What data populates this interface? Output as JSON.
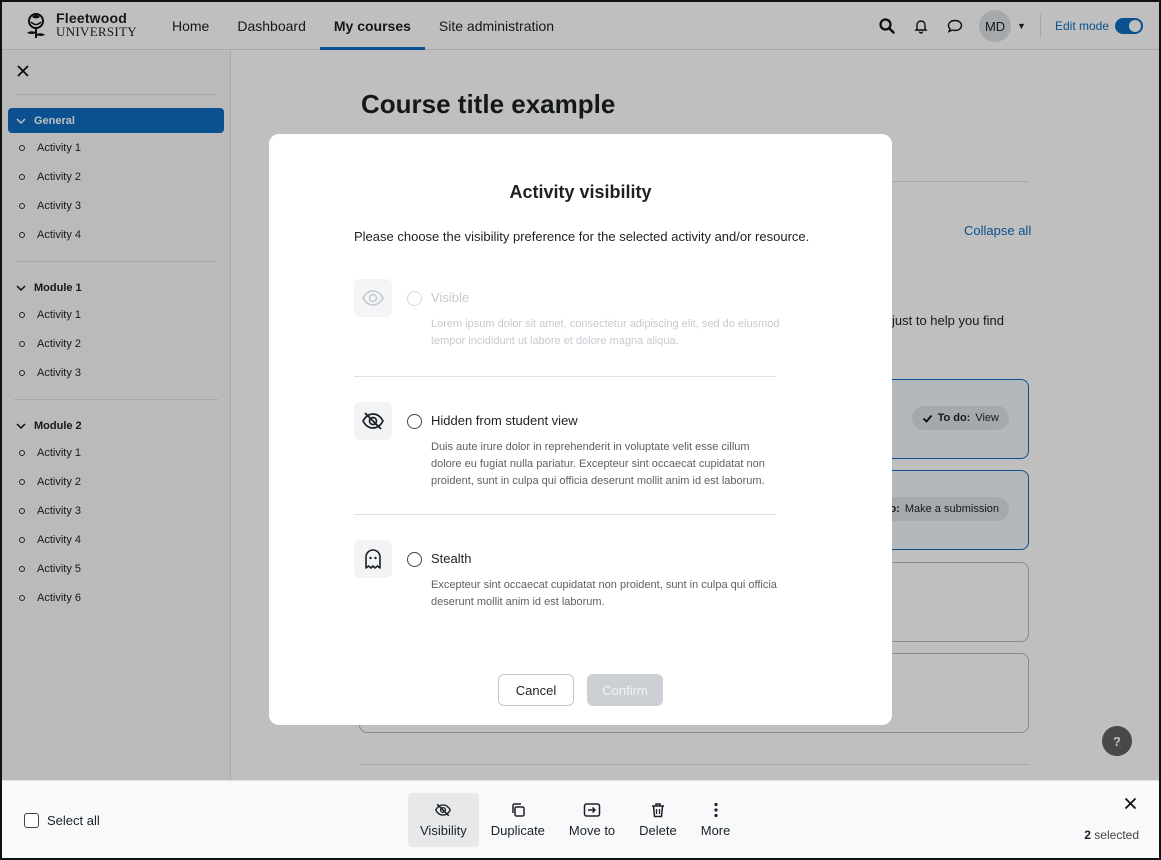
{
  "brand": {
    "line1": "Fleetwood",
    "line2": "UNIVERSITY"
  },
  "nav": {
    "links": [
      "Home",
      "Dashboard",
      "My courses",
      "Site administration"
    ],
    "active_index": 2,
    "user_initials": "MD",
    "edit_mode_label": "Edit mode",
    "edit_mode_on": true
  },
  "drawer": {
    "sections": [
      {
        "title": "General",
        "active": true,
        "items": [
          "Activity 1",
          "Activity 2",
          "Activity 3",
          "Activity 4"
        ]
      },
      {
        "title": "Module 1",
        "active": false,
        "items": [
          "Activity 1",
          "Activity 2",
          "Activity 3"
        ]
      },
      {
        "title": "Module 2",
        "active": false,
        "items": [
          "Activity 1",
          "Activity 2",
          "Activity 3",
          "Activity 4",
          "Activity 5",
          "Activity 6"
        ]
      }
    ]
  },
  "page": {
    "title": "Course title example",
    "collapse_all": "Collapse all",
    "partial_text": "just to help you find",
    "badge_1": {
      "strong": "To do:",
      "rest": "View"
    },
    "badge_2": {
      "strong": "o:",
      "rest": "Make a submission"
    },
    "help_label": "?"
  },
  "modal": {
    "title": "Activity visibility",
    "description": "Please choose the visibility preference for the selected activity and/or resource.",
    "options": [
      {
        "label": "Visible",
        "text": "Lorem ipsum dolor sit amet, consectetur adipiscing elit, sed do eiusmod tempor incididunt ut labore et dolore magna aliqua.",
        "disabled": true,
        "icon": "eye-icon"
      },
      {
        "label": "Hidden from student view",
        "text": "Duis aute irure dolor in reprehenderit in voluptate velit esse cillum dolore eu fugiat nulla pariatur. Excepteur sint occaecat cupidatat non proident, sunt in culpa qui officia deserunt mollit anim id est laborum.",
        "disabled": false,
        "icon": "eye-slash-icon"
      },
      {
        "label": "Stealth",
        "text": "Excepteur sint occaecat cupidatat non proident, sunt in culpa qui officia deserunt mollit anim id est laborum.",
        "disabled": false,
        "icon": "ghost-icon"
      }
    ],
    "cancel_label": "Cancel",
    "confirm_label": "Confirm"
  },
  "bulk": {
    "select_all_label": "Select all",
    "actions": [
      {
        "label": "Visibility",
        "icon": "eye-slash-icon",
        "active": true
      },
      {
        "label": "Duplicate",
        "icon": "copy-icon",
        "active": false
      },
      {
        "label": "Move to",
        "icon": "move-icon",
        "active": false
      },
      {
        "label": "Delete",
        "icon": "trash-icon",
        "active": false
      },
      {
        "label": "More",
        "icon": "more-icon",
        "active": false
      }
    ],
    "selected_count": "2",
    "selected_suffix": " selected"
  },
  "colors": {
    "accent": "#0f6cbf",
    "text": "#1d2125",
    "muted": "#5e6063",
    "overlay": "#00000040"
  }
}
